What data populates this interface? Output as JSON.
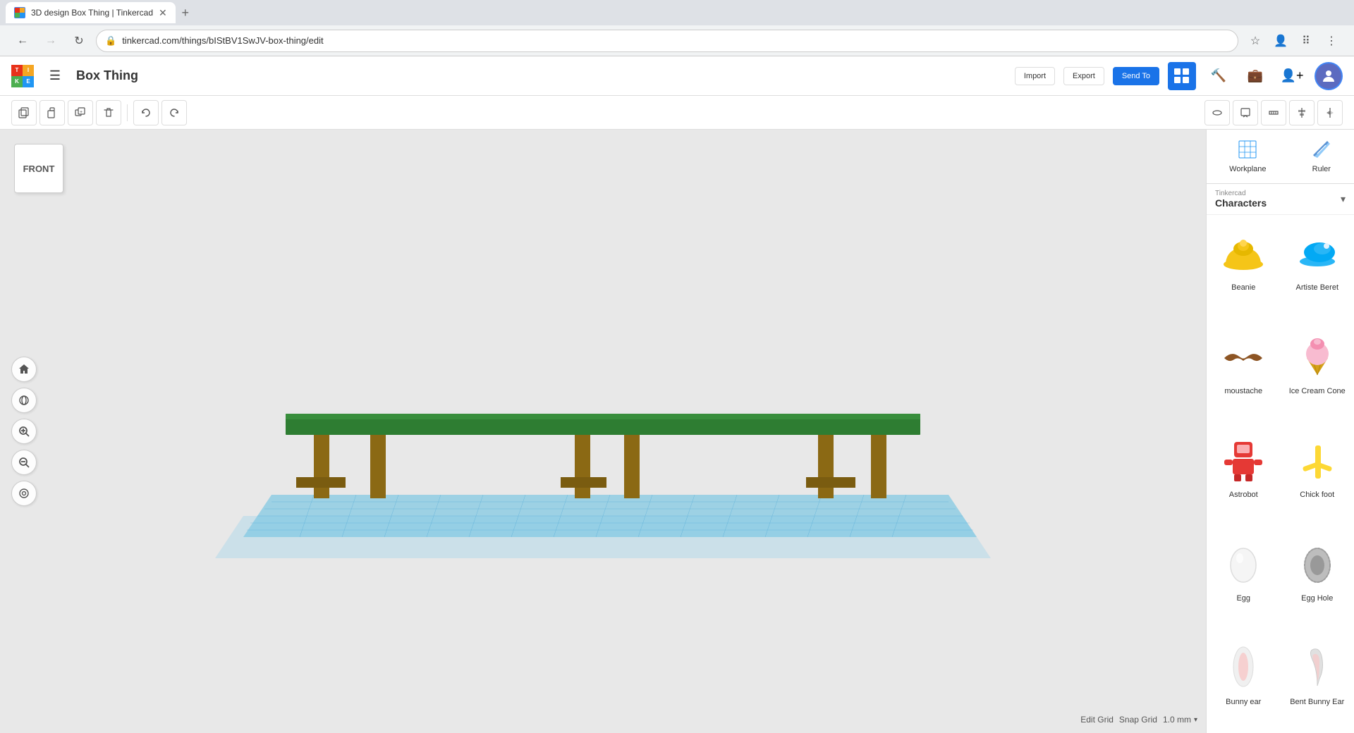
{
  "browser": {
    "tab_title": "3D design Box Thing | Tinkercad",
    "url": "tinkercad.com/things/bIStBV1SwJV-box-thing/edit",
    "new_tab_label": "+"
  },
  "header": {
    "app_title": "Box Thing",
    "import_label": "Import",
    "export_label": "Export",
    "send_to_label": "Send To"
  },
  "toolbar": {
    "copy_tooltip": "Copy",
    "paste_tooltip": "Paste",
    "duplicate_tooltip": "Duplicate",
    "delete_tooltip": "Delete",
    "undo_tooltip": "Undo",
    "redo_tooltip": "Redo"
  },
  "viewport": {
    "front_label": "FRONT",
    "snap_label": "Snap Grid",
    "snap_value": "1.0 mm",
    "edit_grid_label": "Edit Grid"
  },
  "right_panel": {
    "workplane_label": "Workplane",
    "ruler_label": "Ruler",
    "category_source": "Tinkercad",
    "category_name": "Characters",
    "shapes": [
      {
        "id": "beanie",
        "label": "Beanie",
        "color": "#f5c518"
      },
      {
        "id": "artiste-beret",
        "label": "Artiste Beret",
        "color": "#29b6f6"
      },
      {
        "id": "moustache",
        "label": "moustache",
        "color": "#8d5524"
      },
      {
        "id": "ice-cream-cone",
        "label": "Ice Cream Cone",
        "color": "#f8bbd0"
      },
      {
        "id": "astrobot",
        "label": "Astrobot",
        "color": "#e53935"
      },
      {
        "id": "chick-foot",
        "label": "Chick foot",
        "color": "#fdd835"
      },
      {
        "id": "egg",
        "label": "Egg",
        "color": "#f5f5f5"
      },
      {
        "id": "egg-hole",
        "label": "Egg Hole",
        "color": "#bdbdbd"
      },
      {
        "id": "bunny-ear",
        "label": "Bunny ear",
        "color": "#f0f0f0"
      },
      {
        "id": "bent-bunny-ear",
        "label": "Bent Bunny Ear",
        "color": "#e0e0e0"
      }
    ]
  },
  "view_controls": {
    "home": "⌂",
    "orbit": "↺",
    "zoom_in": "+",
    "zoom_out": "−",
    "perspective": "◎"
  }
}
